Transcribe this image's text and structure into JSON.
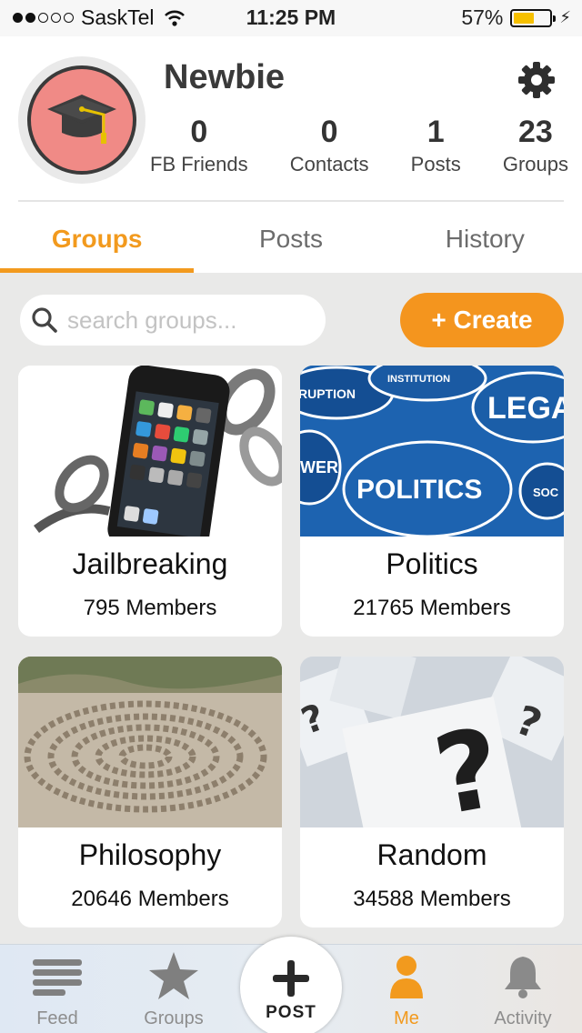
{
  "status_bar": {
    "carrier": "SaskTel",
    "time": "11:25 PM",
    "battery": "57%",
    "battery_level": 0.57
  },
  "profile": {
    "username": "Newbie",
    "stats": [
      {
        "value": "0",
        "label": "FB Friends"
      },
      {
        "value": "0",
        "label": "Contacts"
      },
      {
        "value": "1",
        "label": "Posts"
      },
      {
        "value": "23",
        "label": "Groups"
      }
    ]
  },
  "tabs": [
    {
      "label": "Groups",
      "active": true
    },
    {
      "label": "Posts",
      "active": false
    },
    {
      "label": "History",
      "active": false
    }
  ],
  "search": {
    "placeholder": "search groups..."
  },
  "create_label": "+ Create",
  "groups": [
    {
      "name": "Jailbreaking",
      "members": "795 Members"
    },
    {
      "name": "Politics",
      "members": "21765 Members"
    },
    {
      "name": "Philosophy",
      "members": "20646 Members"
    },
    {
      "name": "Random",
      "members": "34588 Members"
    }
  ],
  "politics_image_words": [
    "POLITICS",
    "LEGA",
    "INSTITUTION",
    "RUPTION",
    "WER",
    "SOC"
  ],
  "tab_bar": {
    "feed": "Feed",
    "groups": "Groups",
    "post": "POST",
    "me": "Me",
    "activity": "Activity"
  },
  "accent_color": "#f29a1e"
}
